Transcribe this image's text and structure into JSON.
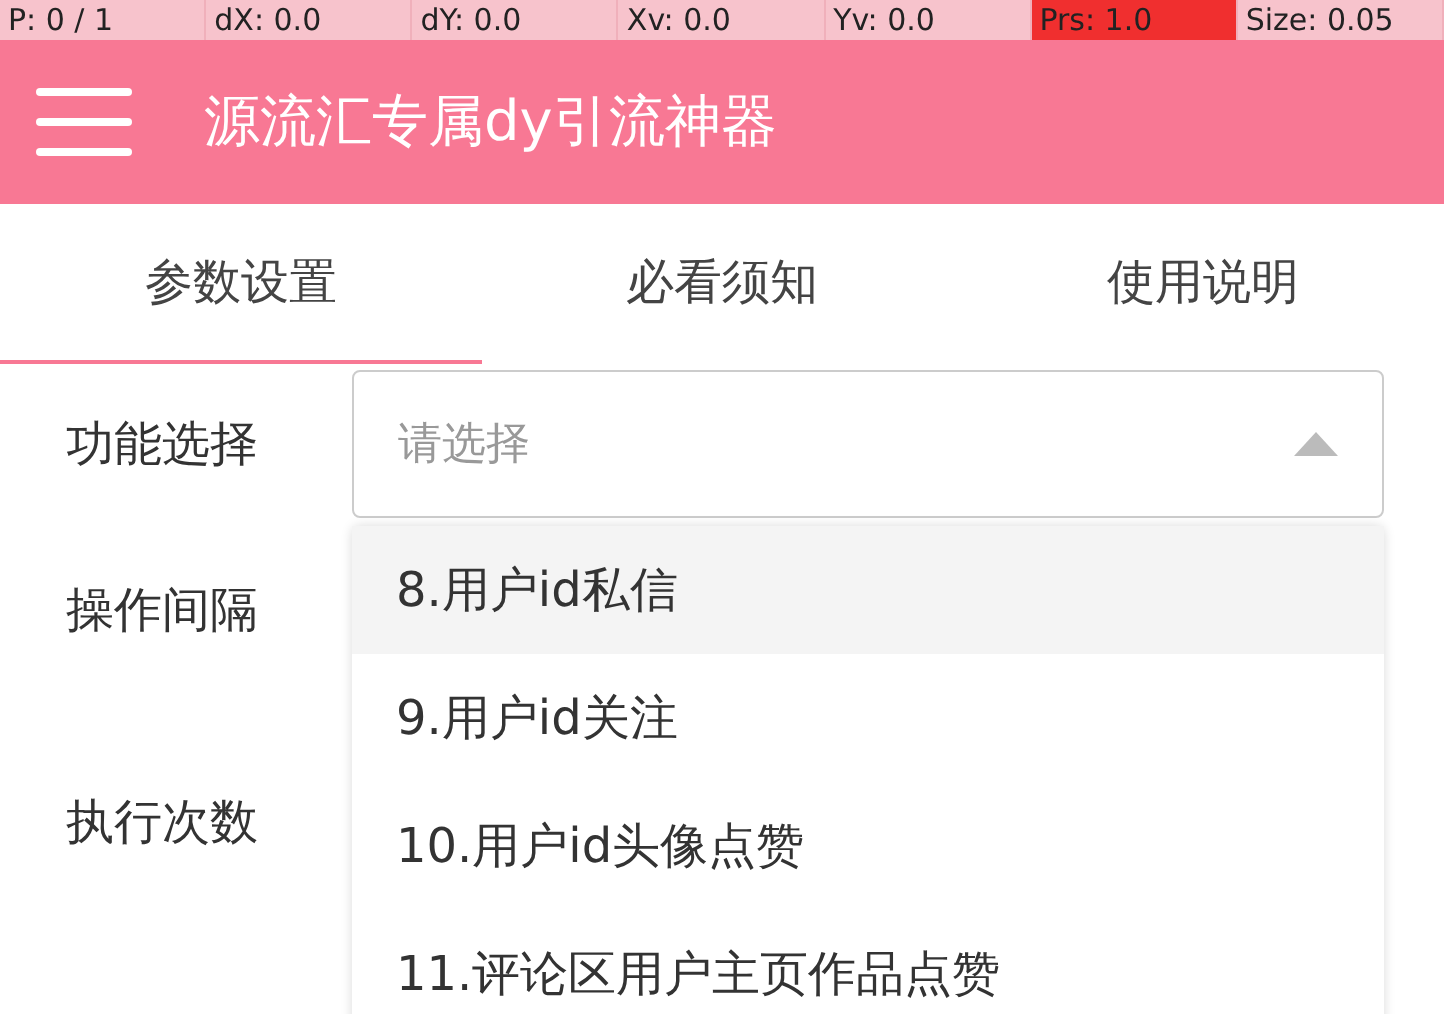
{
  "debug_bar": [
    {
      "text": "P: 0 / 1",
      "highlighted": false
    },
    {
      "text": "dX: 0.0",
      "highlighted": false
    },
    {
      "text": "dY: 0.0",
      "highlighted": false
    },
    {
      "text": "Xv: 0.0",
      "highlighted": false
    },
    {
      "text": "Yv: 0.0",
      "highlighted": false
    },
    {
      "text": "Prs: 1.0",
      "highlighted": true
    },
    {
      "text": "Size: 0.05",
      "highlighted": false
    }
  ],
  "app_bar": {
    "title": "源流汇专属dy引流神器"
  },
  "tabs": [
    {
      "label": "参数设置",
      "selected": true
    },
    {
      "label": "必看须知",
      "selected": false
    },
    {
      "label": "使用说明",
      "selected": false
    }
  ],
  "form": [
    {
      "label": "功能选择",
      "placeholder": "请选择",
      "expanded": true
    },
    {
      "label": "操作间隔"
    },
    {
      "label": "执行次数"
    }
  ],
  "dropdown": [
    {
      "label": "8.用户id私信",
      "selected": true
    },
    {
      "label": "9.用户id关注",
      "selected": false
    },
    {
      "label": "10.用户id头像点赞",
      "selected": false
    },
    {
      "label": "11.评论区用户主页作品点赞",
      "selected": false
    }
  ]
}
